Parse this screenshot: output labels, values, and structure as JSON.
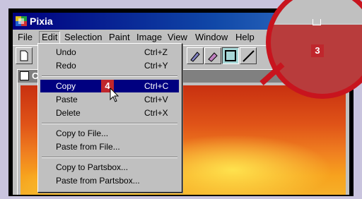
{
  "window": {
    "title": "Pixia"
  },
  "menubar": {
    "items": [
      {
        "label": "File"
      },
      {
        "label": "Edit"
      },
      {
        "label": "Selection"
      },
      {
        "label": "Paint"
      },
      {
        "label": "Image"
      },
      {
        "label": "View"
      },
      {
        "label": "Window"
      },
      {
        "label": "Help"
      }
    ]
  },
  "edit_menu": {
    "items": [
      {
        "label": "Undo",
        "shortcut": "Ctrl+Z"
      },
      {
        "label": "Redo",
        "shortcut": "Ctrl+Y"
      },
      {
        "label": "Copy",
        "shortcut": "Ctrl+C"
      },
      {
        "label": "Paste",
        "shortcut": "Ctrl+V"
      },
      {
        "label": "Delete",
        "shortcut": "Ctrl+X"
      },
      {
        "label": "Copy to File..."
      },
      {
        "label": "Paste from File..."
      },
      {
        "label": "Copy to Partsbox..."
      },
      {
        "label": "Paste from Partsbox..."
      }
    ],
    "highlighted": "Copy"
  },
  "document": {
    "title_letter": "C"
  },
  "callouts": {
    "step_copy": "4",
    "step_magnified": "3"
  },
  "colors": {
    "accent": "#c8141e",
    "highlight": "#000080"
  },
  "icons": [
    "pixia-app-icon",
    "new-document-icon",
    "brush-icon",
    "eraser-icon",
    "rectangle-tool-icon",
    "line-tool-icon",
    "mouse-pointer-icon"
  ]
}
